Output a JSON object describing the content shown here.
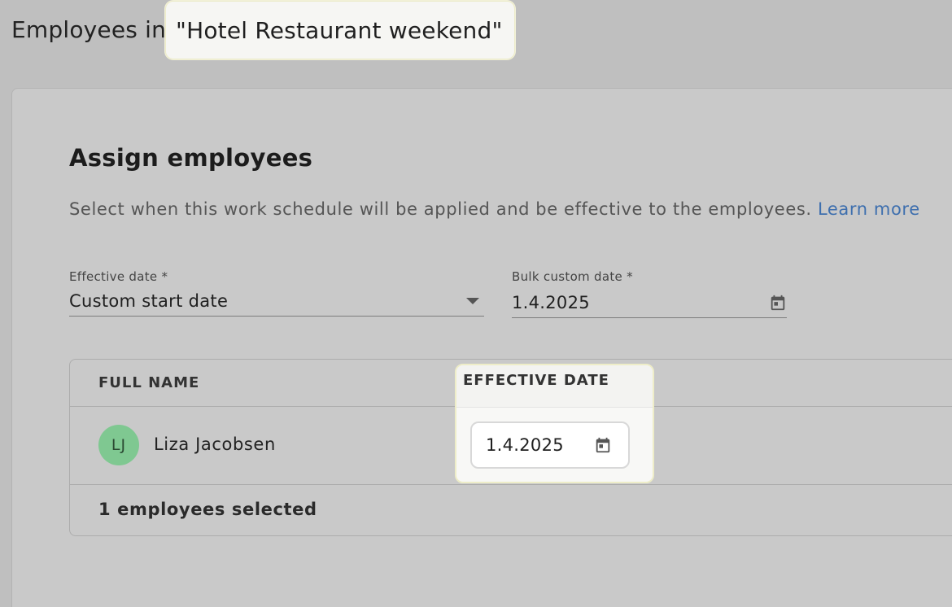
{
  "header": {
    "prefix": "Employees in ",
    "schedule_name": "\"Hotel Restaurant weekend\""
  },
  "section": {
    "title": "Assign employees",
    "description": "Select when this work schedule will be applied and be effective to the employees.",
    "learn_more": "Learn more"
  },
  "fields": {
    "effective_date": {
      "label": "Effective date *",
      "value": "Custom start date",
      "icon": "chevron-down-icon"
    },
    "bulk_custom_date": {
      "label": "Bulk custom date *",
      "value": "1.4.2025",
      "icon": "calendar-icon"
    }
  },
  "table": {
    "columns": [
      "FULL NAME",
      "EFFECTIVE DATE"
    ],
    "rows": [
      {
        "initials": "LJ",
        "name": "Liza Jacobsen",
        "effective_date": "1.4.2025"
      }
    ],
    "footer": "1 employees selected"
  },
  "colors": {
    "accent_link": "#3e6fae",
    "avatar_bg": "#7fc891",
    "highlight_bg": "#f8f8f6"
  }
}
